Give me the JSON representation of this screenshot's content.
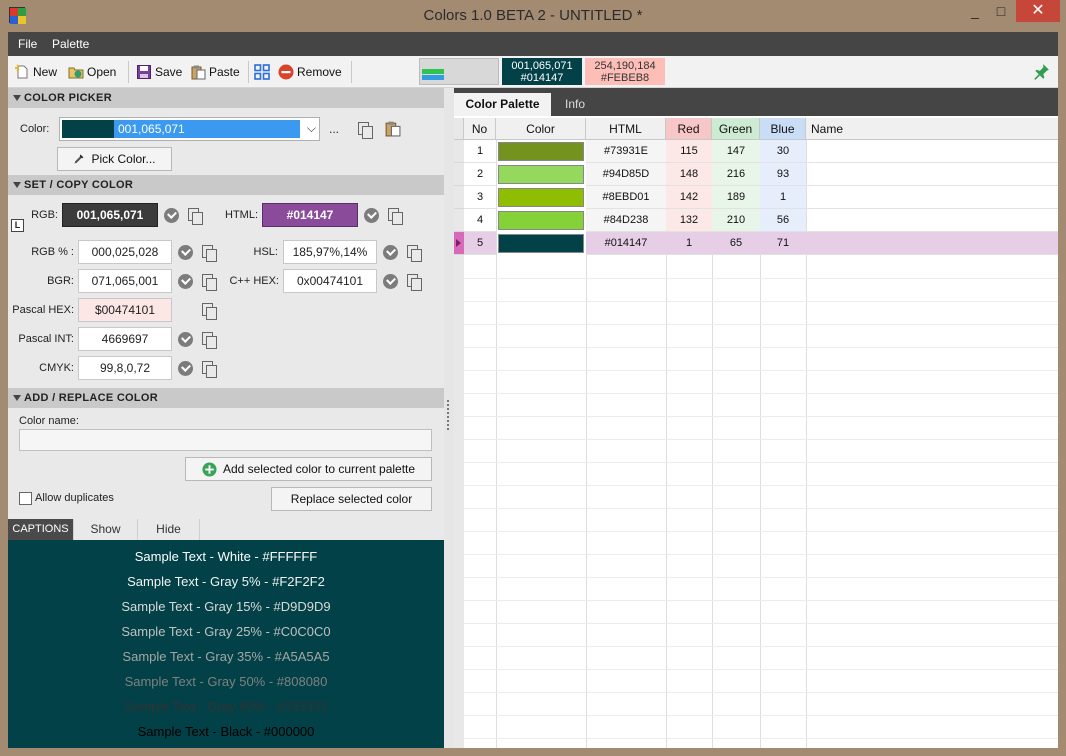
{
  "window": {
    "title": "Colors 1.0 BETA 2 - UNTITLED *",
    "minimize_glyph": "_",
    "maximize_glyph": "□",
    "close_glyph": "✕"
  },
  "menu": {
    "items": [
      "File",
      "Palette"
    ]
  },
  "toolbar": {
    "new_label": "New",
    "open_label": "Open",
    "save_label": "Save",
    "paste_label": "Paste",
    "remove_label": "Remove",
    "current_chip": {
      "rgb": "001,065,071",
      "html": "#014147",
      "bg": "#014147",
      "fg": "#ffffff"
    },
    "previous_chip": {
      "rgb": "254,190,184",
      "html": "#FEBEB8",
      "bg": "#FEBEB8",
      "fg": "#333333"
    }
  },
  "color_picker": {
    "header": "COLOR PICKER",
    "color_label": "Color:",
    "selected_value": "001,065,071",
    "ellipsis": "...",
    "pick_button": "Pick Color..."
  },
  "set_copy": {
    "header": "SET / COPY COLOR",
    "lock_badge": "L",
    "rgb_label": "RGB:",
    "rgb_value": "001,065,071",
    "html_label": "HTML:",
    "html_value": "#014147",
    "rgb_pct_label": "RGB % :",
    "rgb_pct_value": "000,025,028",
    "hsl_label": "HSL:",
    "hsl_value": "185,97%,14%",
    "bgr_label": "BGR:",
    "bgr_value": "071,065,001",
    "cpp_hex_label": "C++ HEX:",
    "cpp_hex_value": "0x00474101",
    "pascal_hex_label": "Pascal HEX:",
    "pascal_hex_value": "$00474101",
    "pascal_int_label": "Pascal INT:",
    "pascal_int_value": "4669697",
    "cmyk_label": "CMYK:",
    "cmyk_value": "99,8,0,72"
  },
  "add_replace": {
    "header": "ADD / REPLACE COLOR",
    "name_label": "Color name:",
    "name_value": "",
    "add_button": "Add selected color to current palette",
    "allow_duplicates": "Allow duplicates",
    "replace_button": "Replace selected color"
  },
  "captions": {
    "tabs": [
      "CAPTIONS",
      "Show",
      "Hide"
    ],
    "background": "#014147",
    "samples": [
      {
        "text": "Sample Text - White - #FFFFFF",
        "color": "#FFFFFF"
      },
      {
        "text": "Sample Text - Gray 5% - #F2F2F2",
        "color": "#F2F2F2"
      },
      {
        "text": "Sample Text - Gray 15% - #D9D9D9",
        "color": "#D9D9D9"
      },
      {
        "text": "Sample Text - Gray 25% - #C0C0C0",
        "color": "#C0C0C0"
      },
      {
        "text": "Sample Text - Gray 35% - #A5A5A5",
        "color": "#A5A5A5"
      },
      {
        "text": "Sample Text - Gray 50% - #808080",
        "color": "#808080"
      },
      {
        "text": "Sample Text - Gray 80% - #333333",
        "color": "#333333"
      },
      {
        "text": "Sample Text - Black - #000000",
        "color": "#000000"
      }
    ]
  },
  "palette": {
    "tabs": [
      "Color Palette",
      "Info"
    ],
    "columns": [
      "No",
      "Color",
      "HTML",
      "Red",
      "Green",
      "Blue",
      "Name"
    ],
    "rows": [
      {
        "no": "1",
        "swatch": "#73931E",
        "html": "#73931E",
        "r": "115",
        "g": "147",
        "b": "30",
        "name": ""
      },
      {
        "no": "2",
        "swatch": "#94D85D",
        "html": "#94D85D",
        "r": "148",
        "g": "216",
        "b": "93",
        "name": ""
      },
      {
        "no": "3",
        "swatch": "#8EBD01",
        "html": "#8EBD01",
        "r": "142",
        "g": "189",
        "b": "1",
        "name": ""
      },
      {
        "no": "4",
        "swatch": "#84D238",
        "html": "#84D238",
        "r": "132",
        "g": "210",
        "b": "56",
        "name": ""
      },
      {
        "no": "5",
        "swatch": "#014147",
        "html": "#014147",
        "r": "1",
        "g": "65",
        "b": "71",
        "name": ""
      }
    ],
    "selected_row": 4
  }
}
